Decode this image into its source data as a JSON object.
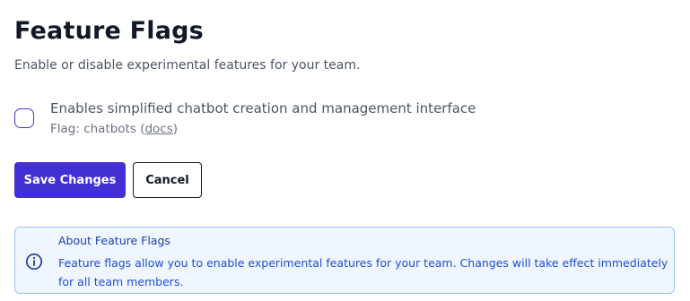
{
  "page": {
    "title": "Feature Flags",
    "subtitle": "Enable or disable experimental features for your team."
  },
  "flags": [
    {
      "description": "Enables simplified chatbot creation and management interface",
      "flag_prefix": "Flag: chatbots (",
      "docs_label": "docs",
      "flag_suffix": ")",
      "enabled": false
    }
  ],
  "actions": {
    "save_label": "Save Changes",
    "cancel_label": "Cancel"
  },
  "info": {
    "title": "About Feature Flags",
    "body": "Feature flags allow you to enable experimental features for your team. Changes will take effect immediately for all team members.",
    "icon": "info-icon"
  },
  "colors": {
    "primary": "#4330d4",
    "info_background": "#eff6ff",
    "info_border": "#93c5fd",
    "info_text": "#1d4ed8"
  }
}
